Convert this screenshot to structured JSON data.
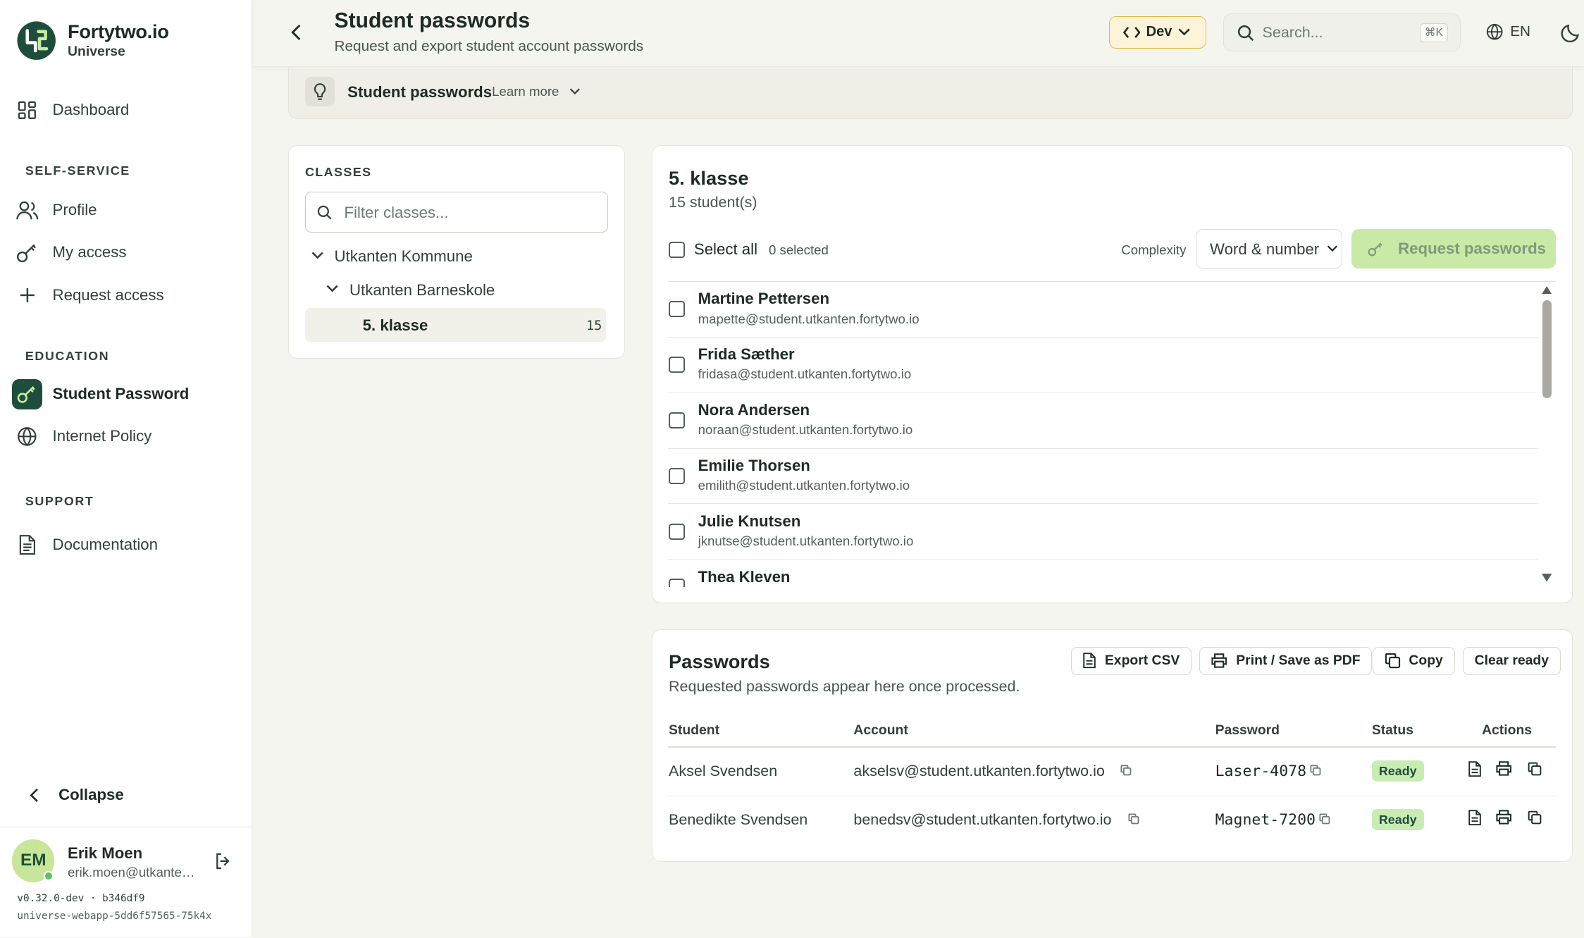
{
  "brand": {
    "name": "Fortytwo.io",
    "sub": "Universe"
  },
  "nav": {
    "dashboard": "Dashboard",
    "self_service_title": "SELF-SERVICE",
    "profile": "Profile",
    "my_access": "My access",
    "request_access": "Request access",
    "education_title": "EDUCATION",
    "student_password": "Student Password",
    "internet_policy": "Internet Policy",
    "support_title": "SUPPORT",
    "documentation": "Documentation",
    "collapse": "Collapse"
  },
  "user": {
    "initials": "EM",
    "name": "Erik Moen",
    "email": "erik.moen@utkanten.fortytwo.io"
  },
  "build": {
    "version": "v0.32.0-dev · b346df9",
    "pod": "universe-webapp-5dd6f57565-75k4x"
  },
  "header": {
    "title": "Student passwords",
    "subtitle": "Request and export student account passwords",
    "env": "Dev",
    "search_placeholder": "Search...",
    "shortcut": "⌘K",
    "lang": "EN"
  },
  "tip": {
    "title": "Student passwords",
    "learn_more": "Learn more"
  },
  "classes": {
    "heading": "CLASSES",
    "filter_placeholder": "Filter classes...",
    "tree": [
      {
        "label": "Utkanten Kommune"
      },
      {
        "label": "Utkanten Barneskole"
      },
      {
        "label": "5. klasse",
        "count": "15"
      }
    ]
  },
  "class_panel": {
    "title": "5. klasse",
    "count": "15 student(s)",
    "select_all": "Select all",
    "selected": "0 selected",
    "complexity_label": "Complexity",
    "complexity_value": "Word & number",
    "request_button": "Request passwords",
    "students": [
      {
        "name": "Martine Pettersen",
        "email": "mapette@student.utkanten.fortytwo.io"
      },
      {
        "name": "Frida Sæther",
        "email": "fridasa@student.utkanten.fortytwo.io"
      },
      {
        "name": "Nora Andersen",
        "email": "noraan@student.utkanten.fortytwo.io"
      },
      {
        "name": "Emilie Thorsen",
        "email": "emilith@student.utkanten.fortytwo.io"
      },
      {
        "name": "Julie Knutsen",
        "email": "jknutse@student.utkanten.fortytwo.io"
      },
      {
        "name": "Thea Kleven",
        "email": ""
      }
    ]
  },
  "passwords": {
    "title": "Passwords",
    "subtitle": "Requested passwords appear here once processed.",
    "buttons": {
      "export": "Export CSV",
      "print": "Print / Save as PDF",
      "copy": "Copy",
      "clear": "Clear ready"
    },
    "columns": [
      "Student",
      "Account",
      "Password",
      "Status",
      "Actions"
    ],
    "rows": [
      {
        "student": "Aksel Svendsen",
        "account": "akselsv@student.utkanten.fortytwo.io",
        "password": "Laser-4078",
        "status": "Ready"
      },
      {
        "student": "Benedikte Svendsen",
        "account": "benedsv@student.utkanten.fortytwo.io",
        "password": "Magnet-7200",
        "status": "Ready"
      }
    ]
  },
  "colors": {
    "brand": "#1f4d3b",
    "accent_lime": "#c8eaa6",
    "ready": "#c8ecb4",
    "dev": "#fcf3d8"
  }
}
